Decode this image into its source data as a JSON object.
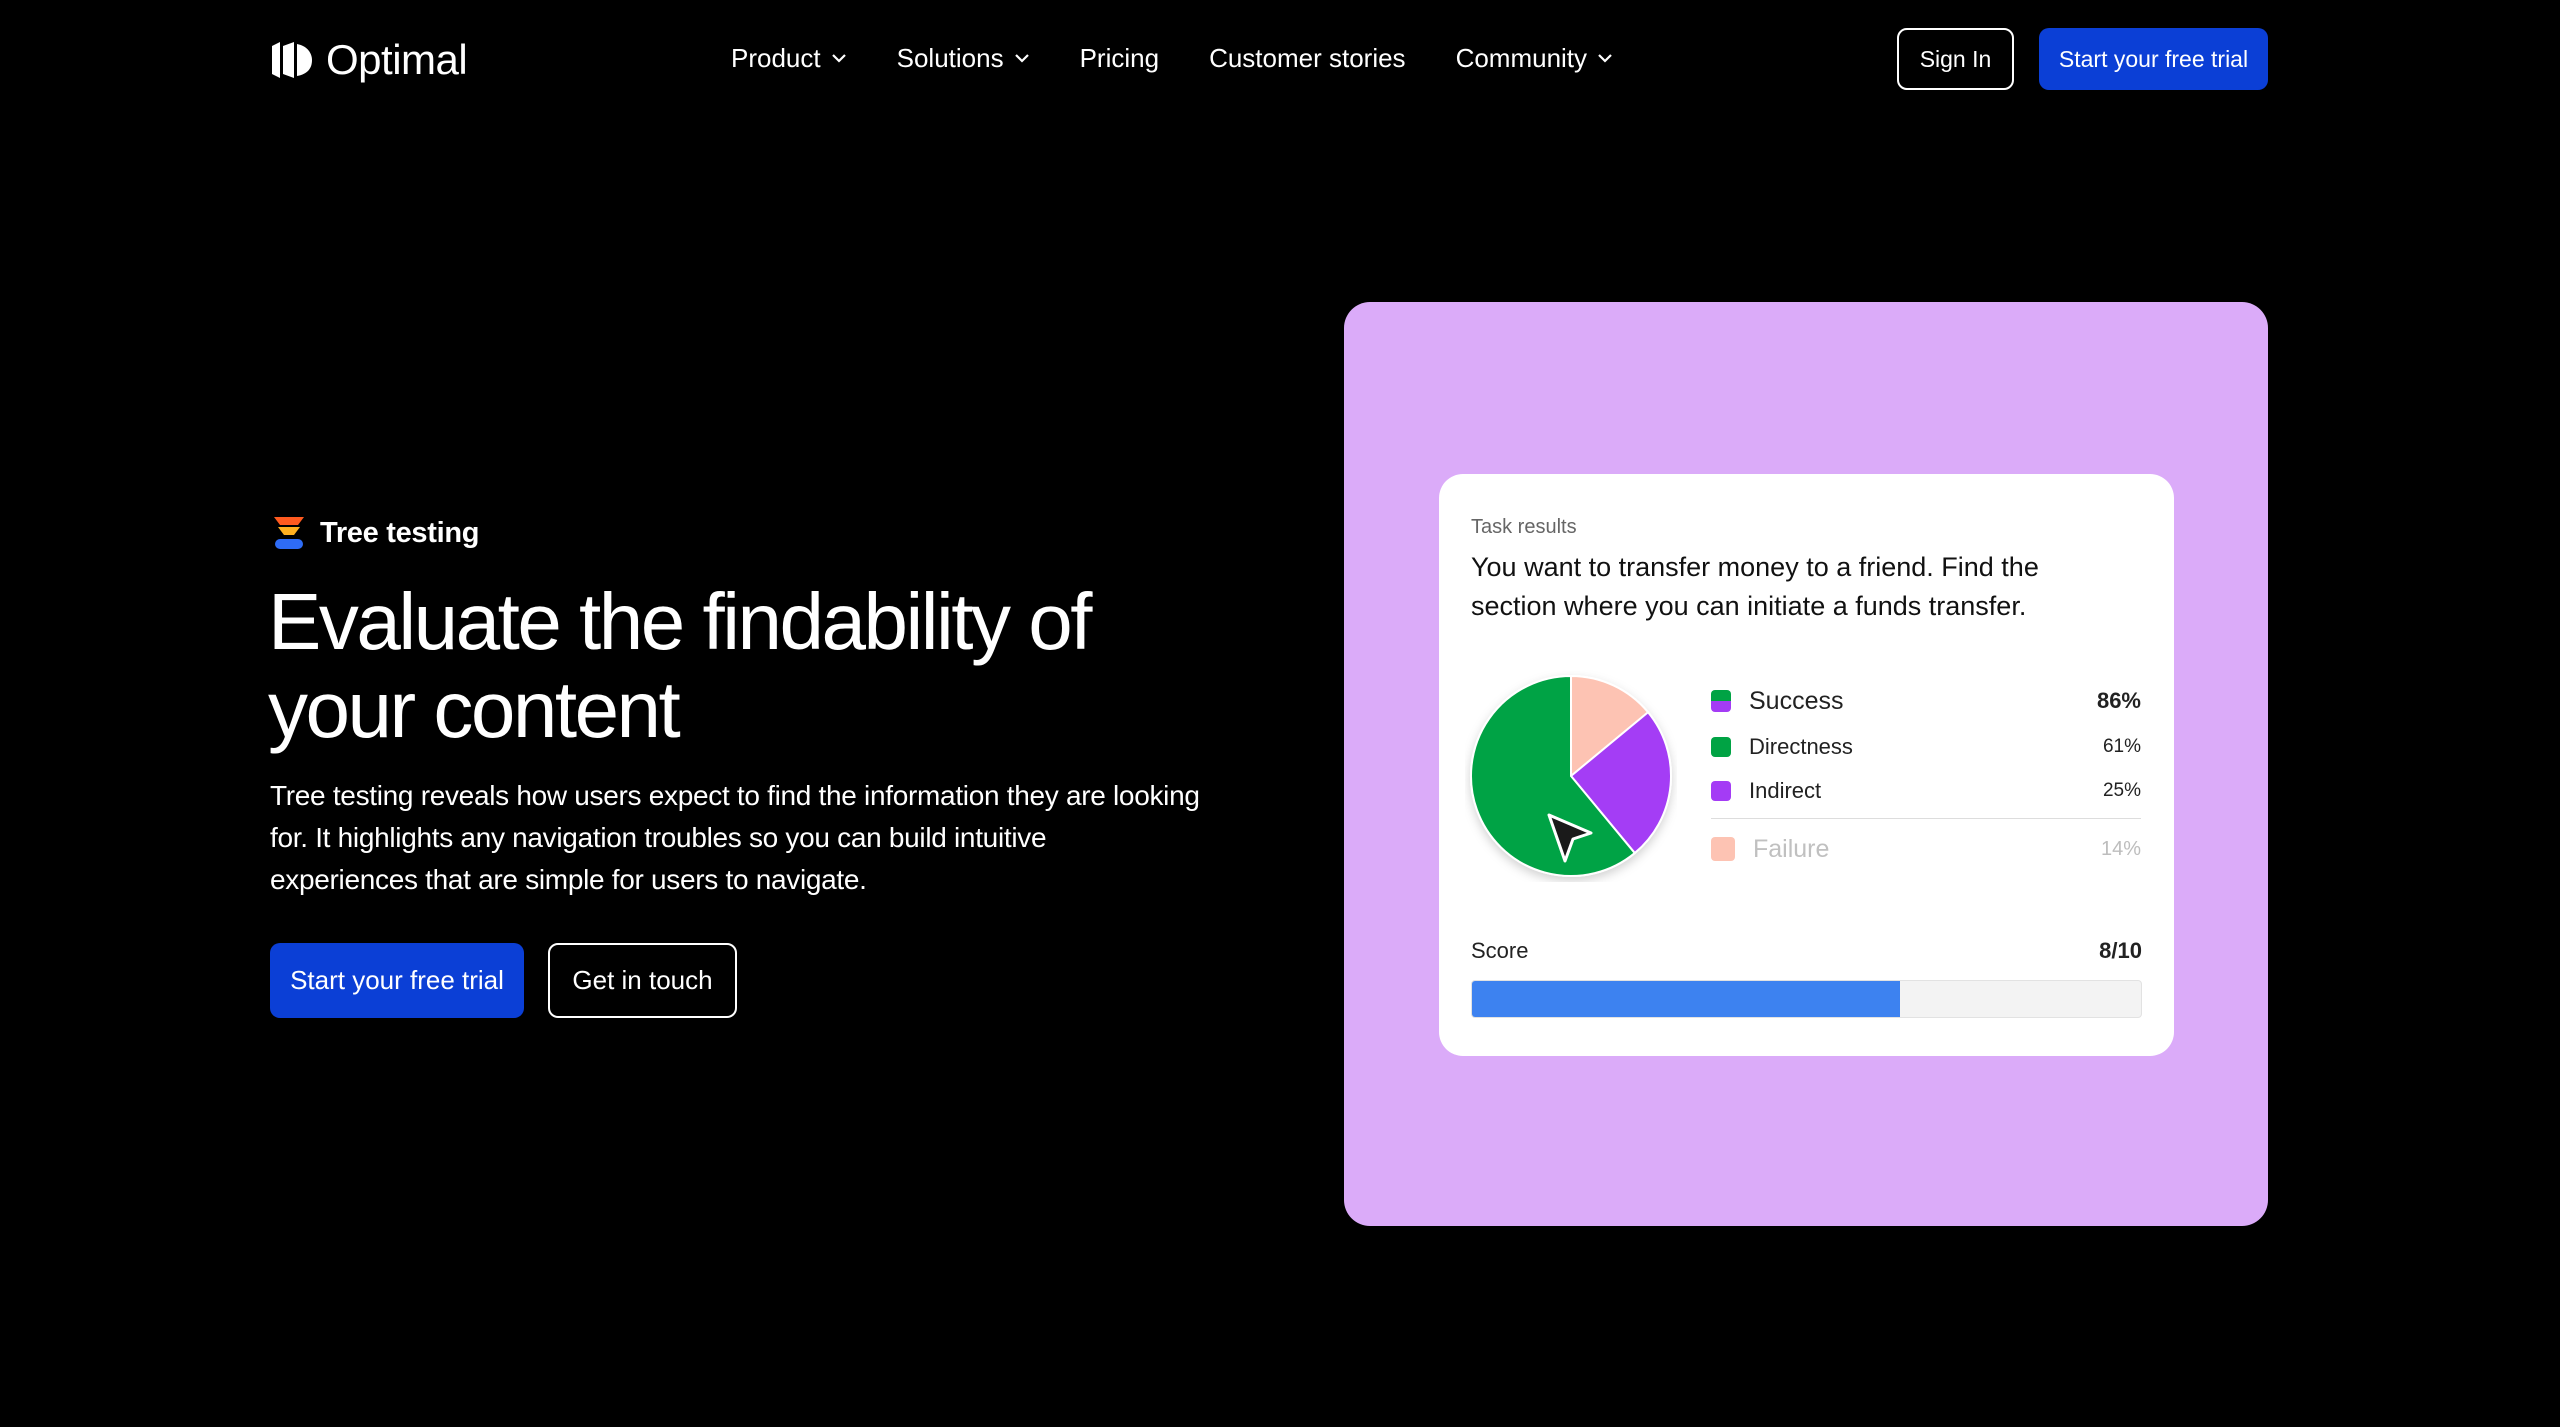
{
  "nav": {
    "brand": "Optimal",
    "links": [
      {
        "label": "Product",
        "dropdown": true
      },
      {
        "label": "Solutions",
        "dropdown": true
      },
      {
        "label": "Pricing",
        "dropdown": false
      },
      {
        "label": "Customer stories",
        "dropdown": false
      },
      {
        "label": "Community",
        "dropdown": true
      }
    ],
    "sign_in": "Sign In",
    "trial": "Start your free trial"
  },
  "hero": {
    "tag": "Tree testing",
    "headline": "Evaluate the findability of your content",
    "description": "Tree testing reveals how users expect to find the information they are looking for. It highlights any navigation troubles so you can build intuitive experiences that are simple for users to navigate.",
    "cta_primary": "Start your free trial",
    "cta_secondary": "Get in touch"
  },
  "card": {
    "label": "Task results",
    "question": "You want to transfer money to a friend. Find the section where you can initiate a funds transfer.",
    "score_label": "Score",
    "score_value": "8/10",
    "score_fraction": 0.64
  },
  "colors": {
    "accent_blue": "#0b3fd6",
    "panel_purple": "#dbabf9",
    "directness": "#00a344",
    "indirect": "#a43cf5",
    "failure": "#fdc3b3",
    "score_bar": "#3d82f0"
  },
  "chart_data": {
    "type": "pie",
    "slices": [
      {
        "name": "Directness",
        "value": 61,
        "color": "#00a344"
      },
      {
        "name": "Indirect",
        "value": 25,
        "color": "#a43cf5"
      },
      {
        "name": "Failure",
        "value": 14,
        "color": "#fdc3b3"
      }
    ],
    "legend": [
      {
        "name": "Success",
        "value": "86%"
      },
      {
        "name": "Directness",
        "value": "61%"
      },
      {
        "name": "Indirect",
        "value": "25%"
      },
      {
        "name": "Failure",
        "value": "14%"
      }
    ]
  }
}
